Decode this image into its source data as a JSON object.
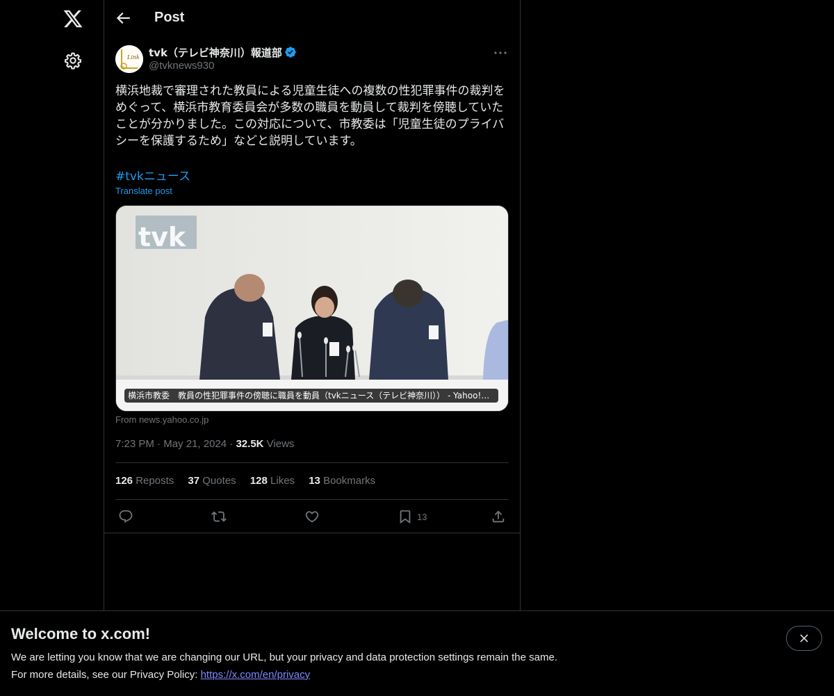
{
  "header": {
    "title": "Post"
  },
  "post": {
    "display_name": "tvk（テレビ神奈川）報道部",
    "handle": "@tvknews930",
    "text": "横浜地裁で審理された教員による児童生徒への複数の性犯罪事件の裁判を\nめぐって、横浜市教育委員会が多数の職員を動員して裁判を傍聴していた\nことが分かりました。この対応について、市教委は「児童生徒のプライバ\nシーを保護するため」などと説明しています。",
    "hashtag": "#tvkニュース",
    "translate": "Translate post",
    "card": {
      "caption": "横浜市教委　教員の性犯罪事件の傍聴に職員を動員（tvkニュース（テレビ神奈川）） - Yahoo!ニュース",
      "source": "From news.yahoo.co.jp",
      "watermark": "tvk"
    },
    "time": "7:23 PM",
    "date": "May 21, 2024",
    "views_count": "32.5K",
    "views_label": "Views",
    "stats": {
      "reposts_count": "126",
      "reposts_label": "Reposts",
      "quotes_count": "37",
      "quotes_label": "Quotes",
      "likes_count": "128",
      "likes_label": "Likes",
      "bookmarks_count": "13",
      "bookmarks_label": "Bookmarks"
    },
    "actions": {
      "bookmark_count": "13"
    }
  },
  "banner": {
    "title": "Welcome to x.com!",
    "line1": "We are letting you know that we are changing our URL, but your privacy and data protection settings remain the same.",
    "line2_prefix": "For more details, see our Privacy Policy: ",
    "link": "https://x.com/en/privacy"
  },
  "colors": {
    "accent": "#1d9bf0",
    "background": "#000000",
    "text": "#e7e9ea",
    "muted": "#71767b",
    "border": "#2f3336"
  },
  "icons": [
    "x-logo-icon",
    "gear-icon",
    "back-arrow-icon",
    "verified-badge-icon",
    "more-icon",
    "reply-icon",
    "repost-icon",
    "like-icon",
    "bookmark-icon",
    "share-icon",
    "close-icon"
  ]
}
